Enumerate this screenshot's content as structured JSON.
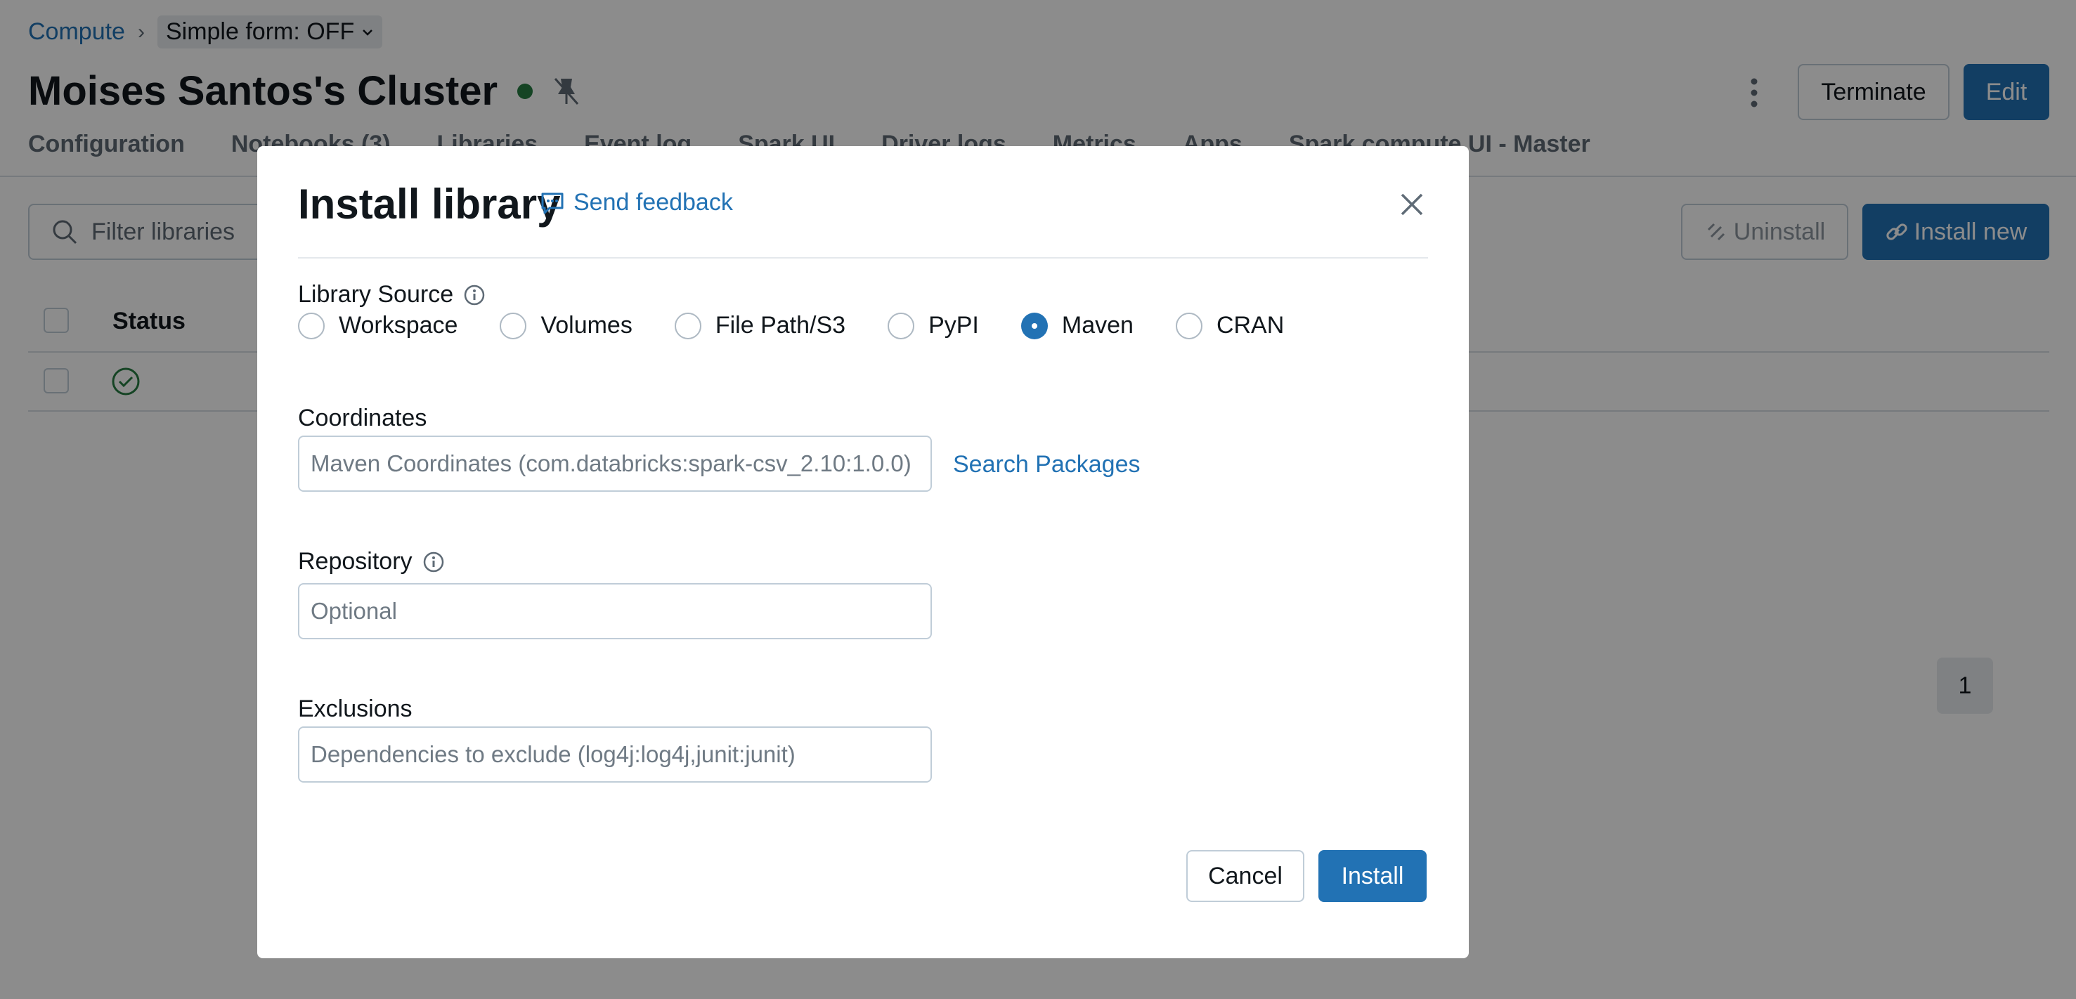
{
  "breadcrumb": {
    "compute": "Compute",
    "separator": "›",
    "simple_form": "Simple form: OFF"
  },
  "page": {
    "title": "Moises Santos's Cluster"
  },
  "actions": {
    "terminate": "Terminate",
    "edit": "Edit"
  },
  "tabs": [
    {
      "label": "Configuration"
    },
    {
      "label": "Notebooks (3)"
    },
    {
      "label": "Libraries"
    },
    {
      "label": "Event log"
    },
    {
      "label": "Spark UI"
    },
    {
      "label": "Driver logs"
    },
    {
      "label": "Metrics"
    },
    {
      "label": "Apps"
    },
    {
      "label": "Spark compute UI - Master"
    }
  ],
  "libraries": {
    "filter_placeholder": "Filter libraries",
    "uninstall": "Uninstall",
    "install_new": "Install new",
    "status_header": "Status",
    "page_number": "1"
  },
  "modal": {
    "title": "Install library",
    "feedback": "Send feedback",
    "source_label": "Library Source",
    "sources": [
      {
        "label": "Workspace"
      },
      {
        "label": "Volumes"
      },
      {
        "label": "File Path/S3"
      },
      {
        "label": "PyPI"
      },
      {
        "label": "Maven"
      },
      {
        "label": "CRAN"
      }
    ],
    "selected_source": "Maven",
    "coordinates_label": "Coordinates",
    "coordinates_placeholder": "Maven Coordinates (com.databricks:spark-csv_2.10:1.0.0)",
    "search_packages": "Search Packages",
    "repository_label": "Repository",
    "repository_placeholder": "Optional",
    "exclusions_label": "Exclusions",
    "exclusions_placeholder": "Dependencies to exclude (log4j:log4j,junit:junit)",
    "cancel": "Cancel",
    "install": "Install"
  },
  "colors": {
    "accent": "#2272b4",
    "status_green": "#277c43",
    "overlay": "rgba(0,0,0,0.45)"
  },
  "icons": [
    "chevron-down-icon",
    "status-dot-icon",
    "pin-off-icon",
    "kebab-menu-icon",
    "search-icon",
    "unlink-icon",
    "link-icon",
    "check-circle-icon",
    "speech-bubble-icon",
    "close-icon",
    "info-icon"
  ]
}
